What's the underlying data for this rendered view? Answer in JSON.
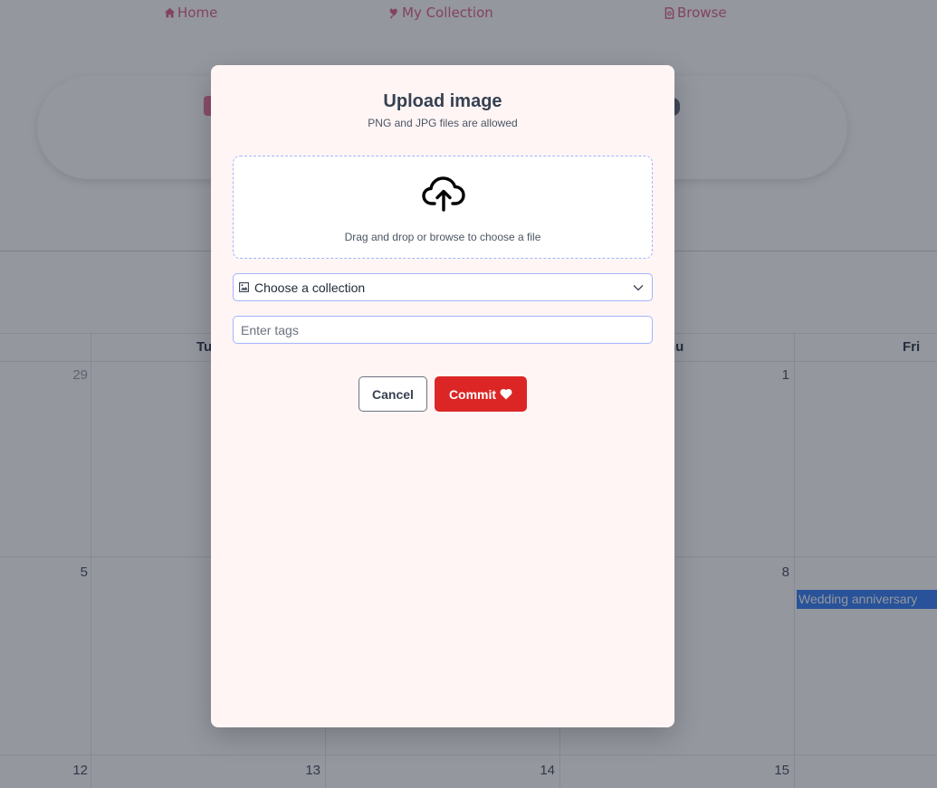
{
  "nav": {
    "home": "Home",
    "collection": "My Collection",
    "browse": "Browse",
    "accent_color": "#e0668e"
  },
  "calendar": {
    "day_headers": [
      "Tu",
      "hu",
      "Fri"
    ],
    "week1": [
      "29",
      "1"
    ],
    "week2": [
      "5",
      "8"
    ],
    "week3": [
      "12",
      "13",
      "14",
      "15"
    ],
    "event": "Wedding anniversary",
    "event_color": "#3b82f6"
  },
  "modal": {
    "title": "Upload image",
    "subtitle": "PNG and JPG files are allowed",
    "dropzone_text": "Drag and drop or browse to choose a file",
    "upload_icon": "cloud-upload-icon",
    "collection_select_label": "Choose a collection",
    "tags_placeholder": "Enter tags",
    "cancel_label": "Cancel",
    "commit_label": "Commit",
    "commit_color": "#dc2626",
    "background": "#fff5f5"
  }
}
